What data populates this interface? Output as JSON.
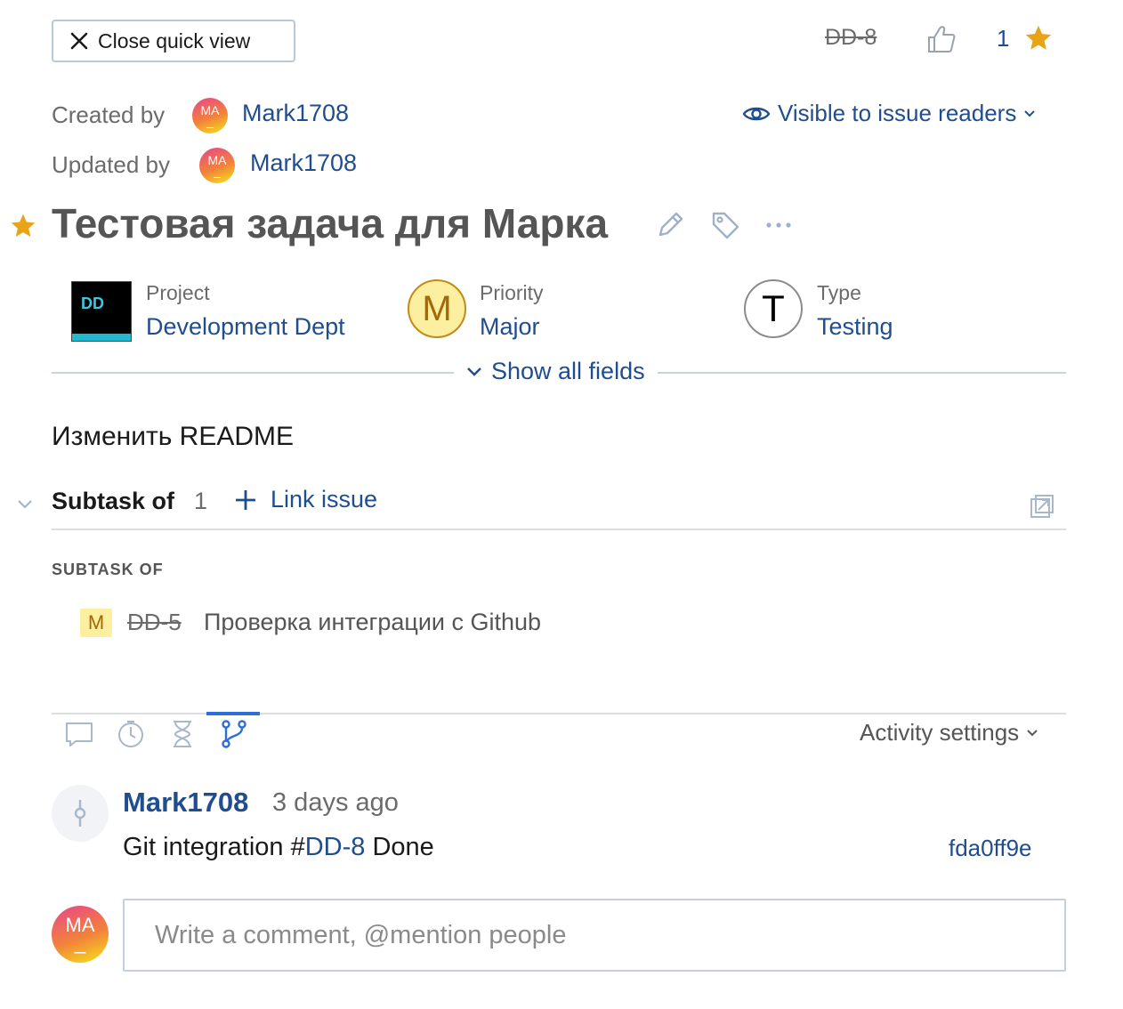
{
  "header": {
    "close_label": "Close quick view",
    "issue_id": "DD-8",
    "votes": "1"
  },
  "meta": {
    "created_label": "Created by",
    "created_user": "Mark1708",
    "updated_label": "Updated by",
    "updated_user": "Mark1708",
    "avatar_initials": "MA",
    "avatar_sub": "_",
    "visibility_label": "Visible to issue readers"
  },
  "issue": {
    "title": "Тестовая задача для Марка",
    "summary": "Изменить README"
  },
  "fields": {
    "project_label": "Project",
    "project_value": "Development Dept",
    "project_logo": "DD",
    "priority_label": "Priority",
    "priority_value": "Major",
    "priority_letter": "M",
    "type_label": "Type",
    "type_value": "Testing",
    "type_letter": "T",
    "show_all_label": "Show all fields"
  },
  "links": {
    "title": "Subtask of",
    "count": "1",
    "link_issue_label": "Link issue",
    "heading": "SUBTASK OF",
    "items": [
      {
        "badge": "M",
        "id": "DD-5",
        "summary": "Проверка интеграции с Github"
      }
    ]
  },
  "activity": {
    "settings_label": "Activity settings",
    "tabs": [
      "comments-icon",
      "history-icon",
      "work-items-icon",
      "vcs-icon"
    ],
    "active_tab": "vcs-icon",
    "commit": {
      "author": "Mark1708",
      "time": "3 days ago",
      "msg_prefix": "Git integration #",
      "msg_issue": "DD-8",
      "msg_suffix": " Done",
      "hash": "fda0ff9e"
    }
  },
  "comment": {
    "placeholder": "Write a comment, @mention people"
  },
  "colors": {
    "link": "#1f4d8f",
    "star": "#e8a317",
    "priority_bg": "#fcef9f",
    "active_tab": "#2d6fd6"
  }
}
